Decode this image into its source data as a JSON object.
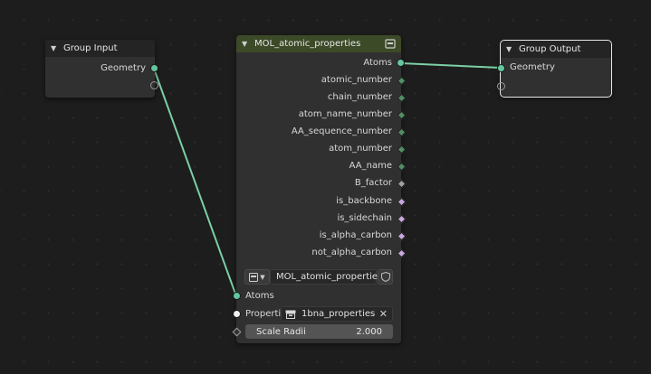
{
  "colors": {
    "background": "#1d1d1d",
    "node_body": "#303030",
    "header_dark": "#242424",
    "header_green": "#3c4a27",
    "geometry_socket": "#62c79e",
    "int_socket": "#528e66",
    "float_socket": "#a1a1a1",
    "bool_socket": "#c9a8e0",
    "link": "#7ccfa6"
  },
  "nodes": {
    "group_input": {
      "title": "Group Input",
      "outputs": [
        "Geometry"
      ]
    },
    "group_output": {
      "title": "Group Output",
      "inputs": [
        "Geometry"
      ]
    },
    "mol": {
      "title": "MOL_atomic_properties",
      "outputs": [
        {
          "label": "Atoms",
          "type": "geometry"
        },
        {
          "label": "atomic_number",
          "type": "int"
        },
        {
          "label": "chain_number",
          "type": "int"
        },
        {
          "label": "atom_name_number",
          "type": "int"
        },
        {
          "label": "AA_sequence_number",
          "type": "int"
        },
        {
          "label": "atom_number",
          "type": "int"
        },
        {
          "label": "AA_name",
          "type": "int"
        },
        {
          "label": "B_factor",
          "type": "float"
        },
        {
          "label": "is_backbone",
          "type": "bool"
        },
        {
          "label": "is_sidechain",
          "type": "bool"
        },
        {
          "label": "is_alpha_carbon",
          "type": "bool"
        },
        {
          "label": "not_alpha_carbon",
          "type": "bool"
        }
      ],
      "group_selector": {
        "icon": "node-tree-icon",
        "value": "MOL_atomic_properties",
        "shield": "shield-icon"
      },
      "inputs": {
        "atoms_label": "Atoms",
        "properties_label": "Properti...",
        "properties_value": "1bna_properties",
        "scale_label": "Scale Radii",
        "scale_value": "2.000"
      }
    }
  }
}
